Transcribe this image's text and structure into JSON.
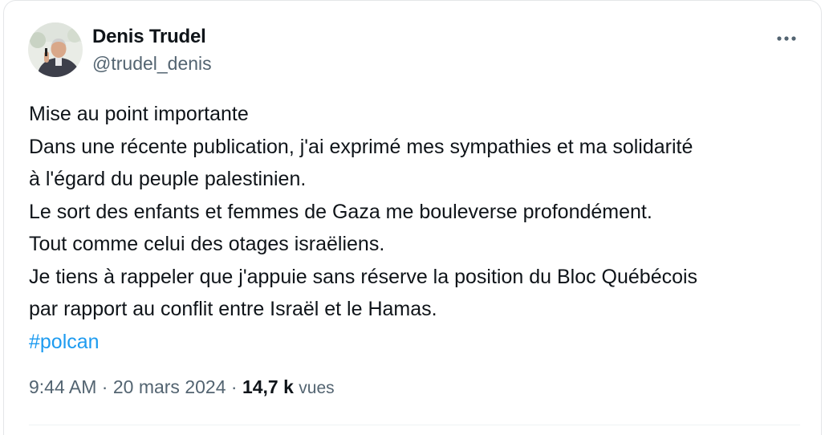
{
  "author": {
    "display_name": "Denis Trudel",
    "handle": "@trudel_denis",
    "avatar_icon": "profile-photo"
  },
  "header": {
    "more_icon": "more-horizontal-icon"
  },
  "tweet": {
    "lines": [
      "Mise au point importante",
      "Dans une récente publication, j'ai exprimé mes sympathies et ma solidarité",
      "à l'égard du peuple palestinien.",
      "Le sort des enfants et femmes de Gaza me bouleverse profondément.",
      "Tout comme celui des otages israëliens.",
      "Je tiens à rappeler que j'appuie sans réserve la position du Bloc Québécois",
      "par rapport au conflit entre Israël et le Hamas."
    ],
    "hashtag": "#polcan"
  },
  "meta": {
    "time": "9:44 AM",
    "separator": " · ",
    "date": "20 mars 2024",
    "views_count": "14,7 k",
    "views_label": "vues"
  },
  "colors": {
    "text": "#0f1419",
    "secondary": "#536471",
    "link": "#1d9bf0"
  }
}
